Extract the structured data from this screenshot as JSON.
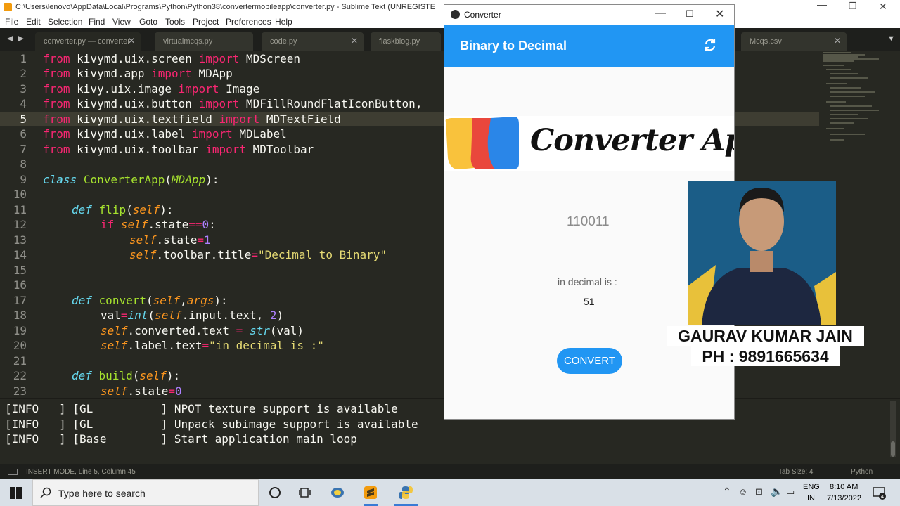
{
  "sublime": {
    "title": "C:\\Users\\lenovo\\AppData\\Local\\Programs\\Python\\Python38\\convertermobileapp\\converter.py - Sublime Text (UNREGISTE",
    "menu": [
      "File",
      "Edit",
      "Selection",
      "Find",
      "View",
      "Goto",
      "Tools",
      "Project",
      "Preferences",
      "Help"
    ],
    "tabs": [
      {
        "label": "converter.py — converter",
        "active": true
      },
      {
        "label": "virtualmcqs.py",
        "active": false
      },
      {
        "label": "code.py",
        "active": false
      },
      {
        "label": "flaskblog.py",
        "active": false
      },
      {
        "label": "Mcqs.csv",
        "active": false
      }
    ],
    "line_numbers": [
      "1",
      "2",
      "3",
      "4",
      "5",
      "6",
      "7",
      "8",
      "9",
      "10",
      "11",
      "12",
      "13",
      "14",
      "15",
      "16",
      "17",
      "18",
      "19",
      "20",
      "21",
      "22",
      "23"
    ],
    "current_line": "5",
    "console": [
      "[INFO   ] [GL          ] NPOT texture support is available",
      "[INFO   ] [GL          ] Unpack subimage support is available",
      "[INFO   ] [Base        ] Start application main loop"
    ],
    "status_left": "INSERT MODE, Line 5, Column 45",
    "status_tab": "Tab Size: 4",
    "status_lang": "Python"
  },
  "code": {
    "l1": {
      "a": "from",
      "b": " kivymd.uix.screen ",
      "c": "import",
      "d": " MDScreen"
    },
    "l2": {
      "a": "from",
      "b": " kivymd.app ",
      "c": "import",
      "d": " MDApp"
    },
    "l3": {
      "a": "from",
      "b": " kivy.uix.image ",
      "c": "import",
      "d": " Image"
    },
    "l4": {
      "a": "from",
      "b": " kivymd.uix.button ",
      "c": "import",
      "d": " MDFillRoundFlatIconButton,"
    },
    "l5": {
      "a": "from",
      "b": " kivymd.uix.textfield ",
      "c": "import",
      "d": " MDTextField"
    },
    "l6": {
      "a": "from",
      "b": " kivymd.uix.label ",
      "c": "import",
      "d": " MDLabel"
    },
    "l7": {
      "a": "from",
      "b": " kivymd.uix.toolbar ",
      "c": "import",
      "d": " MDToolbar"
    },
    "l9": {
      "a": "class",
      "b": " ",
      "c": "ConverterApp",
      "d": "(",
      "e": "MDApp",
      "f": "):"
    },
    "l11": {
      "a": "def",
      "b": " ",
      "c": "flip",
      "d": "(",
      "e": "self",
      "f": "):"
    },
    "l12": {
      "a": "if",
      "b": " ",
      "c": "self",
      "d": ".state",
      "e": "==",
      "f": "0",
      ":": ":"
    },
    "l13": {
      "a": "self",
      "b": ".state",
      "c": "=",
      "d": "1"
    },
    "l14": {
      "a": "self",
      "b": ".toolbar.title",
      "c": "=",
      "d": "\"Decimal to Binary\""
    },
    "l17": {
      "a": "def",
      "b": " ",
      "c": "convert",
      "d": "(",
      "e": "self",
      "f": ",",
      "g": "args",
      "h": "):"
    },
    "l18": {
      "a": "val",
      "b": "=",
      "c": "int",
      "d": "(",
      "e": "self",
      "f": ".input.text, ",
      "g": "2",
      "h": ")"
    },
    "l19": {
      "a": "self",
      "b": ".converted.text ",
      "c": "=",
      "d": " ",
      "e": "str",
      "f": "(val)"
    },
    "l20": {
      "a": "self",
      "b": ".label.text",
      "c": "=",
      "d": "\"in decimal is :\""
    },
    "l22": {
      "a": "def",
      "b": " ",
      "c": "build",
      "d": "(",
      "e": "self",
      "f": "):"
    },
    "l23": {
      "a": "self",
      "b": ".state",
      "c": "=",
      "d": "0"
    }
  },
  "converter": {
    "window_title": "Converter",
    "toolbar_title": "Binary to Decimal",
    "logo_text": "Converter App",
    "input_value": "110011",
    "label_text": "in decimal is :",
    "result": "51",
    "button_label": "CONVERT"
  },
  "overlay": {
    "name": "GAURAV KUMAR JAIN",
    "phone": "PH : 9891665634"
  },
  "taskbar": {
    "search_placeholder": "Type here to search",
    "lang_1": "ENG",
    "lang_2": "IN",
    "time": "8:10 AM",
    "date": "7/13/2022"
  },
  "colors": {
    "accent": "#2196f3",
    "editor_bg": "#272822",
    "keyword": "#f92672",
    "function": "#a6e22e"
  }
}
